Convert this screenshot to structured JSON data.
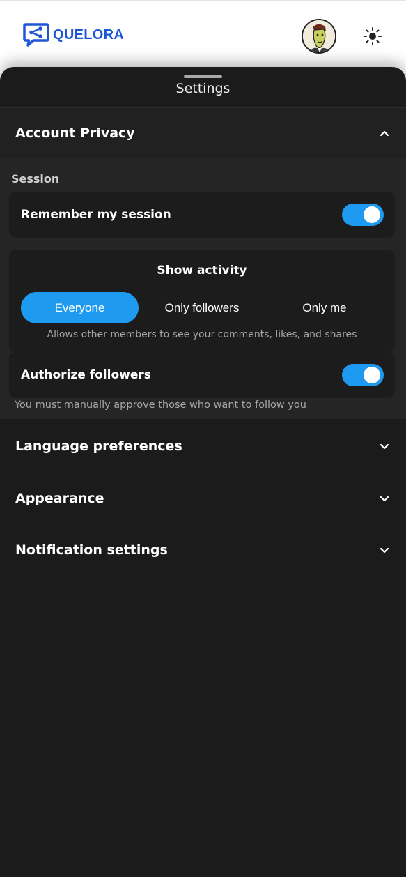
{
  "header": {
    "brand": "QUELORA",
    "colors": {
      "brand": "#1d57d6",
      "accent": "#1e9bf0",
      "sheet": "#1b1b1b"
    },
    "icons": {
      "logo": "share-bubble-icon",
      "avatar": "user-avatar",
      "theme": "sun-icon"
    }
  },
  "sheet": {
    "title": "Settings"
  },
  "sections": {
    "account_privacy": {
      "title": "Account Privacy",
      "expanded": true,
      "session_label": "Session",
      "remember_session": {
        "label": "Remember my session",
        "enabled": true
      },
      "show_activity": {
        "title": "Show activity",
        "options": [
          "Everyone",
          "Only followers",
          "Only me"
        ],
        "selected": "Everyone",
        "help": "Allows other members to see your comments, likes, and shares"
      },
      "authorize_followers": {
        "label": "Authorize followers",
        "enabled": true,
        "help": "You must manually approve those who want to follow you"
      }
    },
    "language": {
      "title": "Language preferences",
      "expanded": false
    },
    "appearance": {
      "title": "Appearance",
      "expanded": false
    },
    "notifications": {
      "title": "Notification settings",
      "expanded": false
    }
  }
}
